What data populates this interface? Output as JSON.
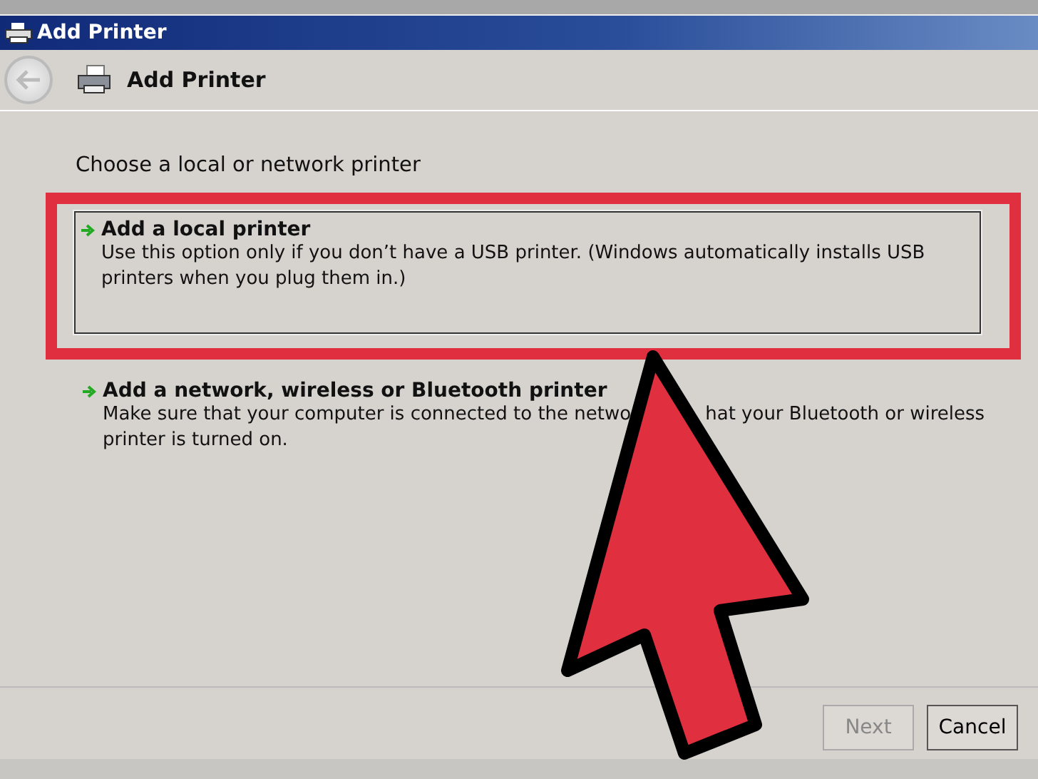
{
  "window": {
    "title": "Add Printer"
  },
  "header": {
    "title": "Add Printer"
  },
  "heading": "Choose a local or network printer",
  "options": [
    {
      "title": "Add a local printer",
      "selected": true,
      "description_lines": [
        [
          "Use this option only if you don’t have a USB printer. (Windows automatically installs USB"
        ],
        [
          "printers when you plug them in.)"
        ]
      ]
    },
    {
      "title": "Add a network, wireless or Bluetooth printer",
      "selected": false,
      "description_lines": [
        [
          "Make sure that your computer is connected to the netwo",
          "hat your Bluetooth or wireless"
        ],
        [
          "printer is turned on."
        ]
      ]
    }
  ],
  "buttons": [
    {
      "label": "Next",
      "disabled": true
    },
    {
      "label": "Cancel",
      "disabled": false
    }
  ]
}
